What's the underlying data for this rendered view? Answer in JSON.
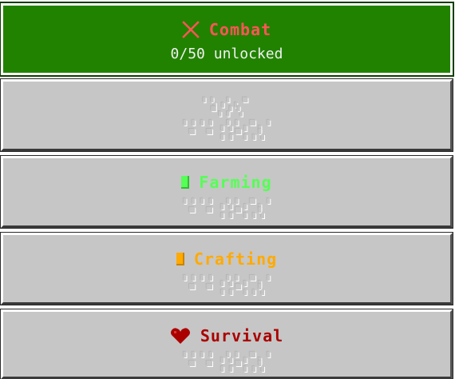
{
  "categories": [
    {
      "title": "Combat",
      "subtitle": "0/50 unlocked",
      "icon": "crossed-swords-icon",
      "color": "#ff5555",
      "selected": true
    },
    {
      "title": "",
      "subtitle": "",
      "icon": "",
      "color": "#c6c6c6",
      "selected": false
    },
    {
      "title": "Farming",
      "subtitle": "",
      "icon": "green-block-icon",
      "color": "#55ff55",
      "selected": false
    },
    {
      "title": "Crafting",
      "subtitle": "",
      "icon": "orange-block-icon",
      "color": "#ffaa00",
      "selected": false
    },
    {
      "title": "Survival",
      "subtitle": "",
      "icon": "heart-icon",
      "color": "#aa0000",
      "selected": false
    }
  ],
  "colors": {
    "selected_bg": "#218200",
    "button_bg": "#c6c6c6"
  }
}
